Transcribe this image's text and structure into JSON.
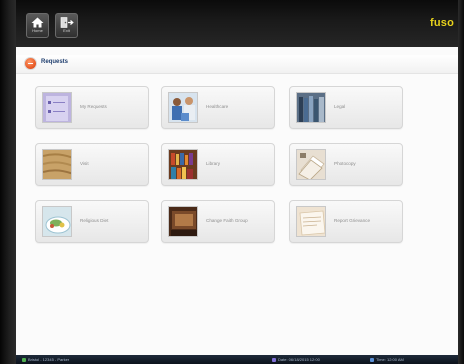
{
  "topbar": {
    "buttons": [
      {
        "name": "home",
        "label": "Home",
        "icon": "home-icon"
      },
      {
        "name": "exit",
        "label": "Exit",
        "icon": "exit-icon"
      }
    ],
    "brand": "fuso"
  },
  "breadcrumb": {
    "icon": "back-icon",
    "title": "Requests"
  },
  "tiles": [
    {
      "label": "My Requests",
      "thumb": "forms"
    },
    {
      "label": "Healthcare",
      "thumb": "people"
    },
    {
      "label": "Legal",
      "thumb": "books"
    },
    {
      "label": "Visit",
      "thumb": "wood"
    },
    {
      "label": "Library",
      "thumb": "shelves"
    },
    {
      "label": "Photocopy",
      "thumb": "copier"
    },
    {
      "label": "Religious Diet",
      "thumb": "meal"
    },
    {
      "label": "Change Faith Group",
      "thumb": "faith"
    },
    {
      "label": "Report Grievance",
      "thumb": "paper"
    }
  ],
  "status": {
    "left": "Bristol - 12345 - Parker",
    "mid": "Date: 06/18/2015 12:00",
    "right": "Time: 12:00 AM"
  },
  "colors": {
    "accent": "#e5531f",
    "brand": "#e8d21c",
    "breadcrumb_text": "#1f3e6e"
  }
}
